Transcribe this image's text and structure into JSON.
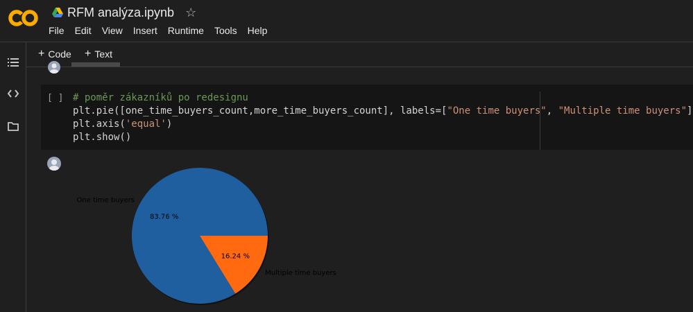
{
  "app": {
    "title": "RFM analýza.ipynb",
    "menu": [
      "File",
      "Edit",
      "View",
      "Insert",
      "Runtime",
      "Tools",
      "Help"
    ]
  },
  "icons": {
    "logo": "colab-logo",
    "drive": "google-drive-icon",
    "star": "star-icon",
    "sidebar": [
      "toc-icon",
      "code-snippets-icon",
      "files-icon"
    ]
  },
  "toolbar": {
    "add_code": "Code",
    "add_text": "Text"
  },
  "cell": {
    "bracket": "[ ]",
    "code_lines": [
      "# poměr zákazníků po redesignu",
      "plt.pie([one_time_buyers_count,more_time_buyers_count], labels=[\"One time buyers\", \"Multiple time buyers\"]",
      "plt.axis('equal')",
      "plt.show()"
    ]
  },
  "chart_data": {
    "type": "pie",
    "categories": [
      "One time buyers",
      "Multiple time buyers"
    ],
    "values": [
      83.76,
      16.24
    ],
    "value_labels": [
      "83.76 %",
      "16.24 %"
    ],
    "colors": [
      "#1f5fa0",
      "#ff6a10"
    ],
    "start_angle_deg": 0
  },
  "colors": {
    "background": "#1f1f1f",
    "cell_background": "#151515",
    "comment": "#6a9955",
    "string": "#ce9178",
    "logo_orange": "#f9ab00"
  }
}
